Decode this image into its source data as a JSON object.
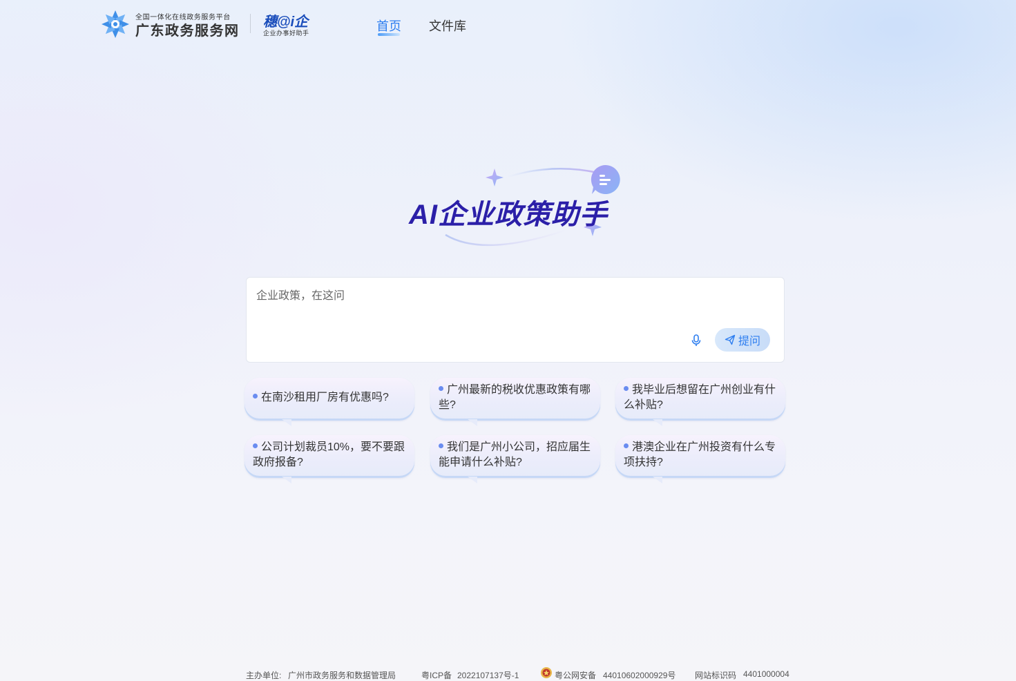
{
  "header": {
    "gd_logo_small": "全国一体化在线政务服务平台",
    "gd_logo_big": "广东政务服务网",
    "sui_logo_big": "穗@i企",
    "sui_logo_small": "企业办事好助手",
    "nav": [
      {
        "label": "首页",
        "active": true
      },
      {
        "label": "文件库",
        "active": false
      }
    ]
  },
  "hero": {
    "title": "AI企业政策助手"
  },
  "ask": {
    "placeholder": "企业政策，在这问",
    "value": "",
    "mic_icon": "microphone-icon",
    "submit_label": "提问",
    "submit_icon": "send-icon"
  },
  "suggestions": [
    "在南沙租用厂房有优惠吗?",
    "广州最新的税收优惠政策有哪些?",
    "我毕业后想留在广州创业有什么补贴?",
    "公司计划裁员10%，要不要跟政府报备?",
    "我们是广州小公司，招应届生能申请什么补贴?",
    "港澳企业在广州投资有什么专项扶持?"
  ],
  "footer": {
    "host_label": "主办单位:",
    "host_value": "广州市政务服务和数据管理局",
    "icp_label": "粤ICP备",
    "icp_value": "2022107137号-1",
    "police_label": "粤公网安备",
    "police_value": "44010602000929号",
    "site_label": "网站标识码",
    "site_value": "4401000004"
  },
  "colors": {
    "accent": "#2e7ef0",
    "hero_title": "#2b1fa8",
    "dot": "#6a8cf0"
  }
}
